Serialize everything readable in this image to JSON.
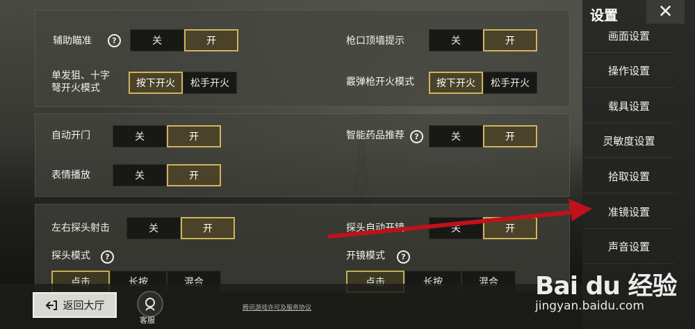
{
  "sidebar": {
    "title": "设置",
    "close_icon": "close-icon",
    "items": [
      {
        "label": "画面设置"
      },
      {
        "label": "操作设置"
      },
      {
        "label": "载具设置"
      },
      {
        "label": "灵敏度设置"
      },
      {
        "label": "拾取设置"
      },
      {
        "label": "准镜设置"
      },
      {
        "label": "声音设置"
      }
    ]
  },
  "section1": {
    "aim_assist": {
      "label": "辅助瞄准",
      "off": "关",
      "on": "开",
      "selected": "on"
    },
    "muzzle_wall": {
      "label": "枪口顶墙提示",
      "off": "关",
      "on": "开",
      "selected": "on"
    },
    "sniper_fire": {
      "label_line1": "单发狙、十字",
      "label_line2": "弩开火模式",
      "opt1": "按下开火",
      "opt2": "松手开火",
      "selected": "opt1"
    },
    "shotgun_fire": {
      "label": "霰弹枪开火模式",
      "opt1": "按下开火",
      "opt2": "松手开火",
      "selected": "opt1"
    }
  },
  "section2": {
    "auto_door": {
      "label": "自动开门",
      "off": "关",
      "on": "开",
      "selected": "on"
    },
    "smart_meds": {
      "label": "智能药品推荐",
      "off": "关",
      "on": "开",
      "selected": "on"
    },
    "emote": {
      "label": "表情播放",
      "off": "关",
      "on": "开",
      "selected": "on"
    }
  },
  "section3": {
    "peek_fire": {
      "label": "左右探头射击",
      "off": "关",
      "on": "开",
      "selected": "on"
    },
    "peek_scope": {
      "label": "探头自动开镜",
      "off": "关",
      "on": "开",
      "selected": "on"
    },
    "peek_mode": {
      "label": "探头模式",
      "options": [
        "点击",
        "长按",
        "混合"
      ],
      "selected": 0
    },
    "scope_mode": {
      "label": "开镜模式",
      "options": [
        "点击",
        "长按",
        "混合"
      ],
      "selected": 0
    }
  },
  "bottom": {
    "back_label": "返回大厅",
    "service_label": "客服",
    "license_link": "腾讯游戏许可及服务协议"
  },
  "watermark": {
    "logo": "Bai du 经验",
    "url": "jingyan.baidu.com"
  },
  "colors": {
    "accent_gold": "#cfb45c",
    "arrow_red": "#c0121a"
  }
}
